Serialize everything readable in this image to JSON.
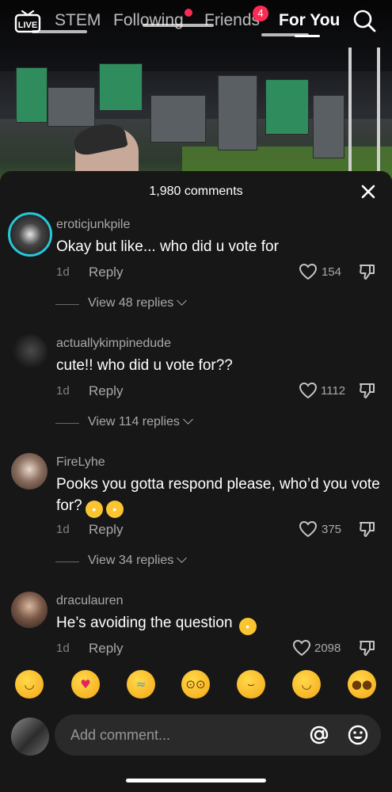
{
  "topnav": {
    "live_label": "LIVE",
    "tabs": [
      {
        "label": "STEM"
      },
      {
        "label": "Following"
      },
      {
        "label": "Friends"
      },
      {
        "label": "For You"
      }
    ],
    "friends_badge": "4",
    "active_tab": "For You"
  },
  "sheet": {
    "title": "1,980 comments",
    "comments": [
      {
        "username": "eroticjunkpile",
        "text": "Okay but like... who did u vote for",
        "time": "1d",
        "reply_label": "Reply",
        "likes": "154",
        "view_replies": "View 48 replies"
      },
      {
        "username": "actuallykimpinedude",
        "text": "cute!! who did u vote for??",
        "time": "1d",
        "reply_label": "Reply",
        "likes": "1112",
        "view_replies": "View 114 replies"
      },
      {
        "username": "FireLyhe",
        "text": "Pooks you gotta respond please, who’d you vote for?",
        "time": "1d",
        "reply_label": "Reply",
        "likes": "375",
        "view_replies": "View 34 replies"
      },
      {
        "username": "draculauren",
        "text": "He’s avoiding the question",
        "time": "1d",
        "reply_label": "Reply",
        "likes": "2098"
      }
    ]
  },
  "emoji_bar": [
    "grinning",
    "smiling-hearts",
    "tears-of-joy",
    "flushed",
    "smirking",
    "sweat-smile",
    "pleading"
  ],
  "composer": {
    "placeholder": "Add comment..."
  },
  "colors": {
    "sheet_bg": "#171717",
    "accent_red": "#fe2c55",
    "avatar_ring": "#25c7d9"
  }
}
